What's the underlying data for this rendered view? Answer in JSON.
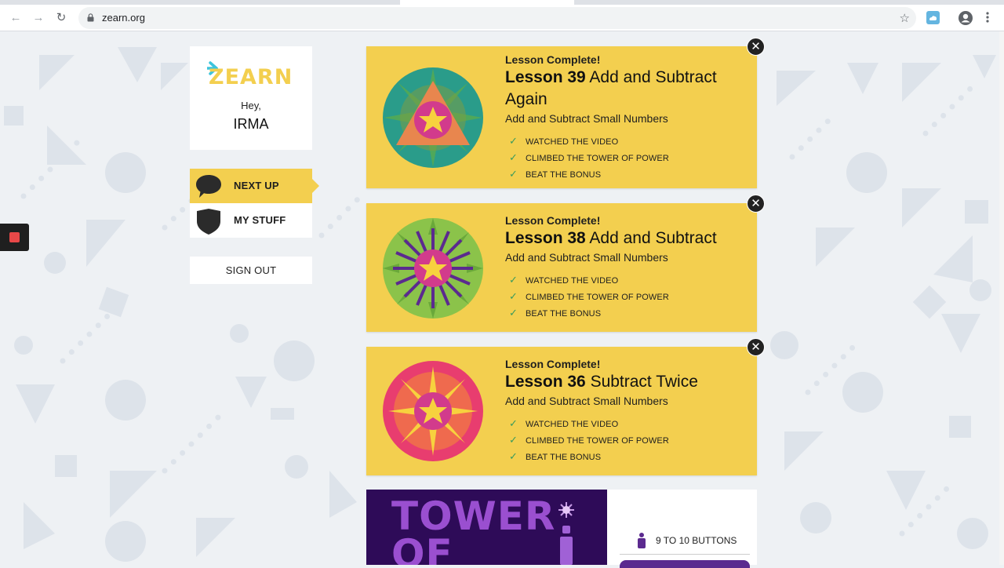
{
  "browser": {
    "url": "zearn.org"
  },
  "sidebar": {
    "logo_text": "ZEARN",
    "greeting": "Hey,",
    "username": "IRMA",
    "nav": [
      {
        "label": "NEXT UP",
        "icon": "speech-bubble-icon",
        "active": true
      },
      {
        "label": "MY STUFF",
        "icon": "shield-icon",
        "active": false
      }
    ],
    "sign_out": "SIGN OUT"
  },
  "lessons": [
    {
      "status": "Lesson Complete!",
      "number": "Lesson 39",
      "name": "Add and Subtract Again",
      "subtitle": "Add and Subtract Small Numbers",
      "checks": [
        "WATCHED THE VIDEO",
        "CLIMBED THE TOWER OF POWER",
        "BEAT THE BONUS"
      ],
      "badge_colors": [
        "#2a9c8a",
        "#e07a4a",
        "#d23b8c"
      ]
    },
    {
      "status": "Lesson Complete!",
      "number": "Lesson 38",
      "name": "Add and Subtract",
      "subtitle": "Add and Subtract Small Numbers",
      "checks": [
        "WATCHED THE VIDEO",
        "CLIMBED THE TOWER OF POWER",
        "BEAT THE BONUS"
      ],
      "badge_colors": [
        "#7cc142",
        "#5b2a8f",
        "#d23b8c"
      ]
    },
    {
      "status": "Lesson Complete!",
      "number": "Lesson 36",
      "name": "Subtract Twice",
      "subtitle": "Add and Subtract Small Numbers",
      "checks": [
        "WATCHED THE VIDEO",
        "CLIMBED THE TOWER OF POWER",
        "BEAT THE BONUS"
      ],
      "badge_colors": [
        "#e83d6f",
        "#f29a3a",
        "#d23b8c"
      ]
    }
  ],
  "tower": {
    "title_line1": "TOWER",
    "title_line2": "OF",
    "buttons_label": "9 TO 10 BUTTONS"
  },
  "colors": {
    "card_yellow": "#f3cf4f",
    "check_green": "#3a9b5d",
    "tower_purple": "#2e0b58"
  }
}
